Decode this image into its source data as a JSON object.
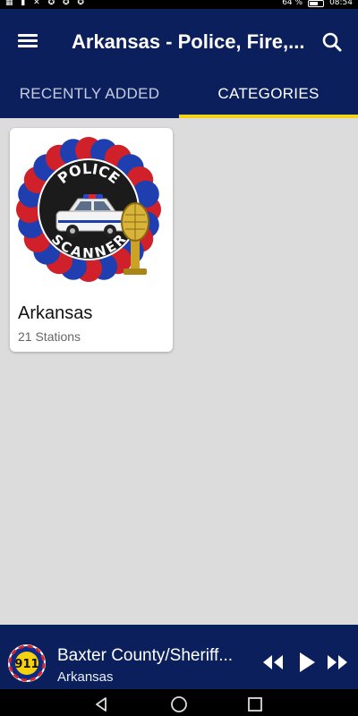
{
  "status_bar": {
    "left_icons": "▦ ▮ ✕ ✪ ✪ ✪",
    "battery_text": "64 %",
    "time": "08:54",
    "battery_level": 0.64
  },
  "app_bar": {
    "title": "Arkansas - Police, Fire,...",
    "menu_icon": "hamburger-menu-icon",
    "search_icon": "search-icon"
  },
  "tabs": [
    {
      "label": "RECENTLY ADDED",
      "active": false
    },
    {
      "label": "CATEGORIES",
      "active": true
    }
  ],
  "categories": [
    {
      "title": "Arkansas",
      "subtitle": "21 Stations",
      "image_icon": "police-scanner-logo-icon",
      "logo_lettering_top": "POLICE",
      "logo_lettering_bottom": "SCANNER"
    }
  ],
  "player": {
    "title": "Baxter County/Sheriff...",
    "subtitle": "Arkansas",
    "logo_text": "911",
    "controls": [
      "rewind-icon",
      "play-icon",
      "fast-forward-icon"
    ]
  },
  "nav_bar": {
    "buttons": [
      "back-icon",
      "home-icon",
      "recents-icon"
    ]
  },
  "colors": {
    "primary": "#0b1f5c",
    "tab_indicator": "#f2d31b",
    "content_background": "#dcdcdc"
  }
}
